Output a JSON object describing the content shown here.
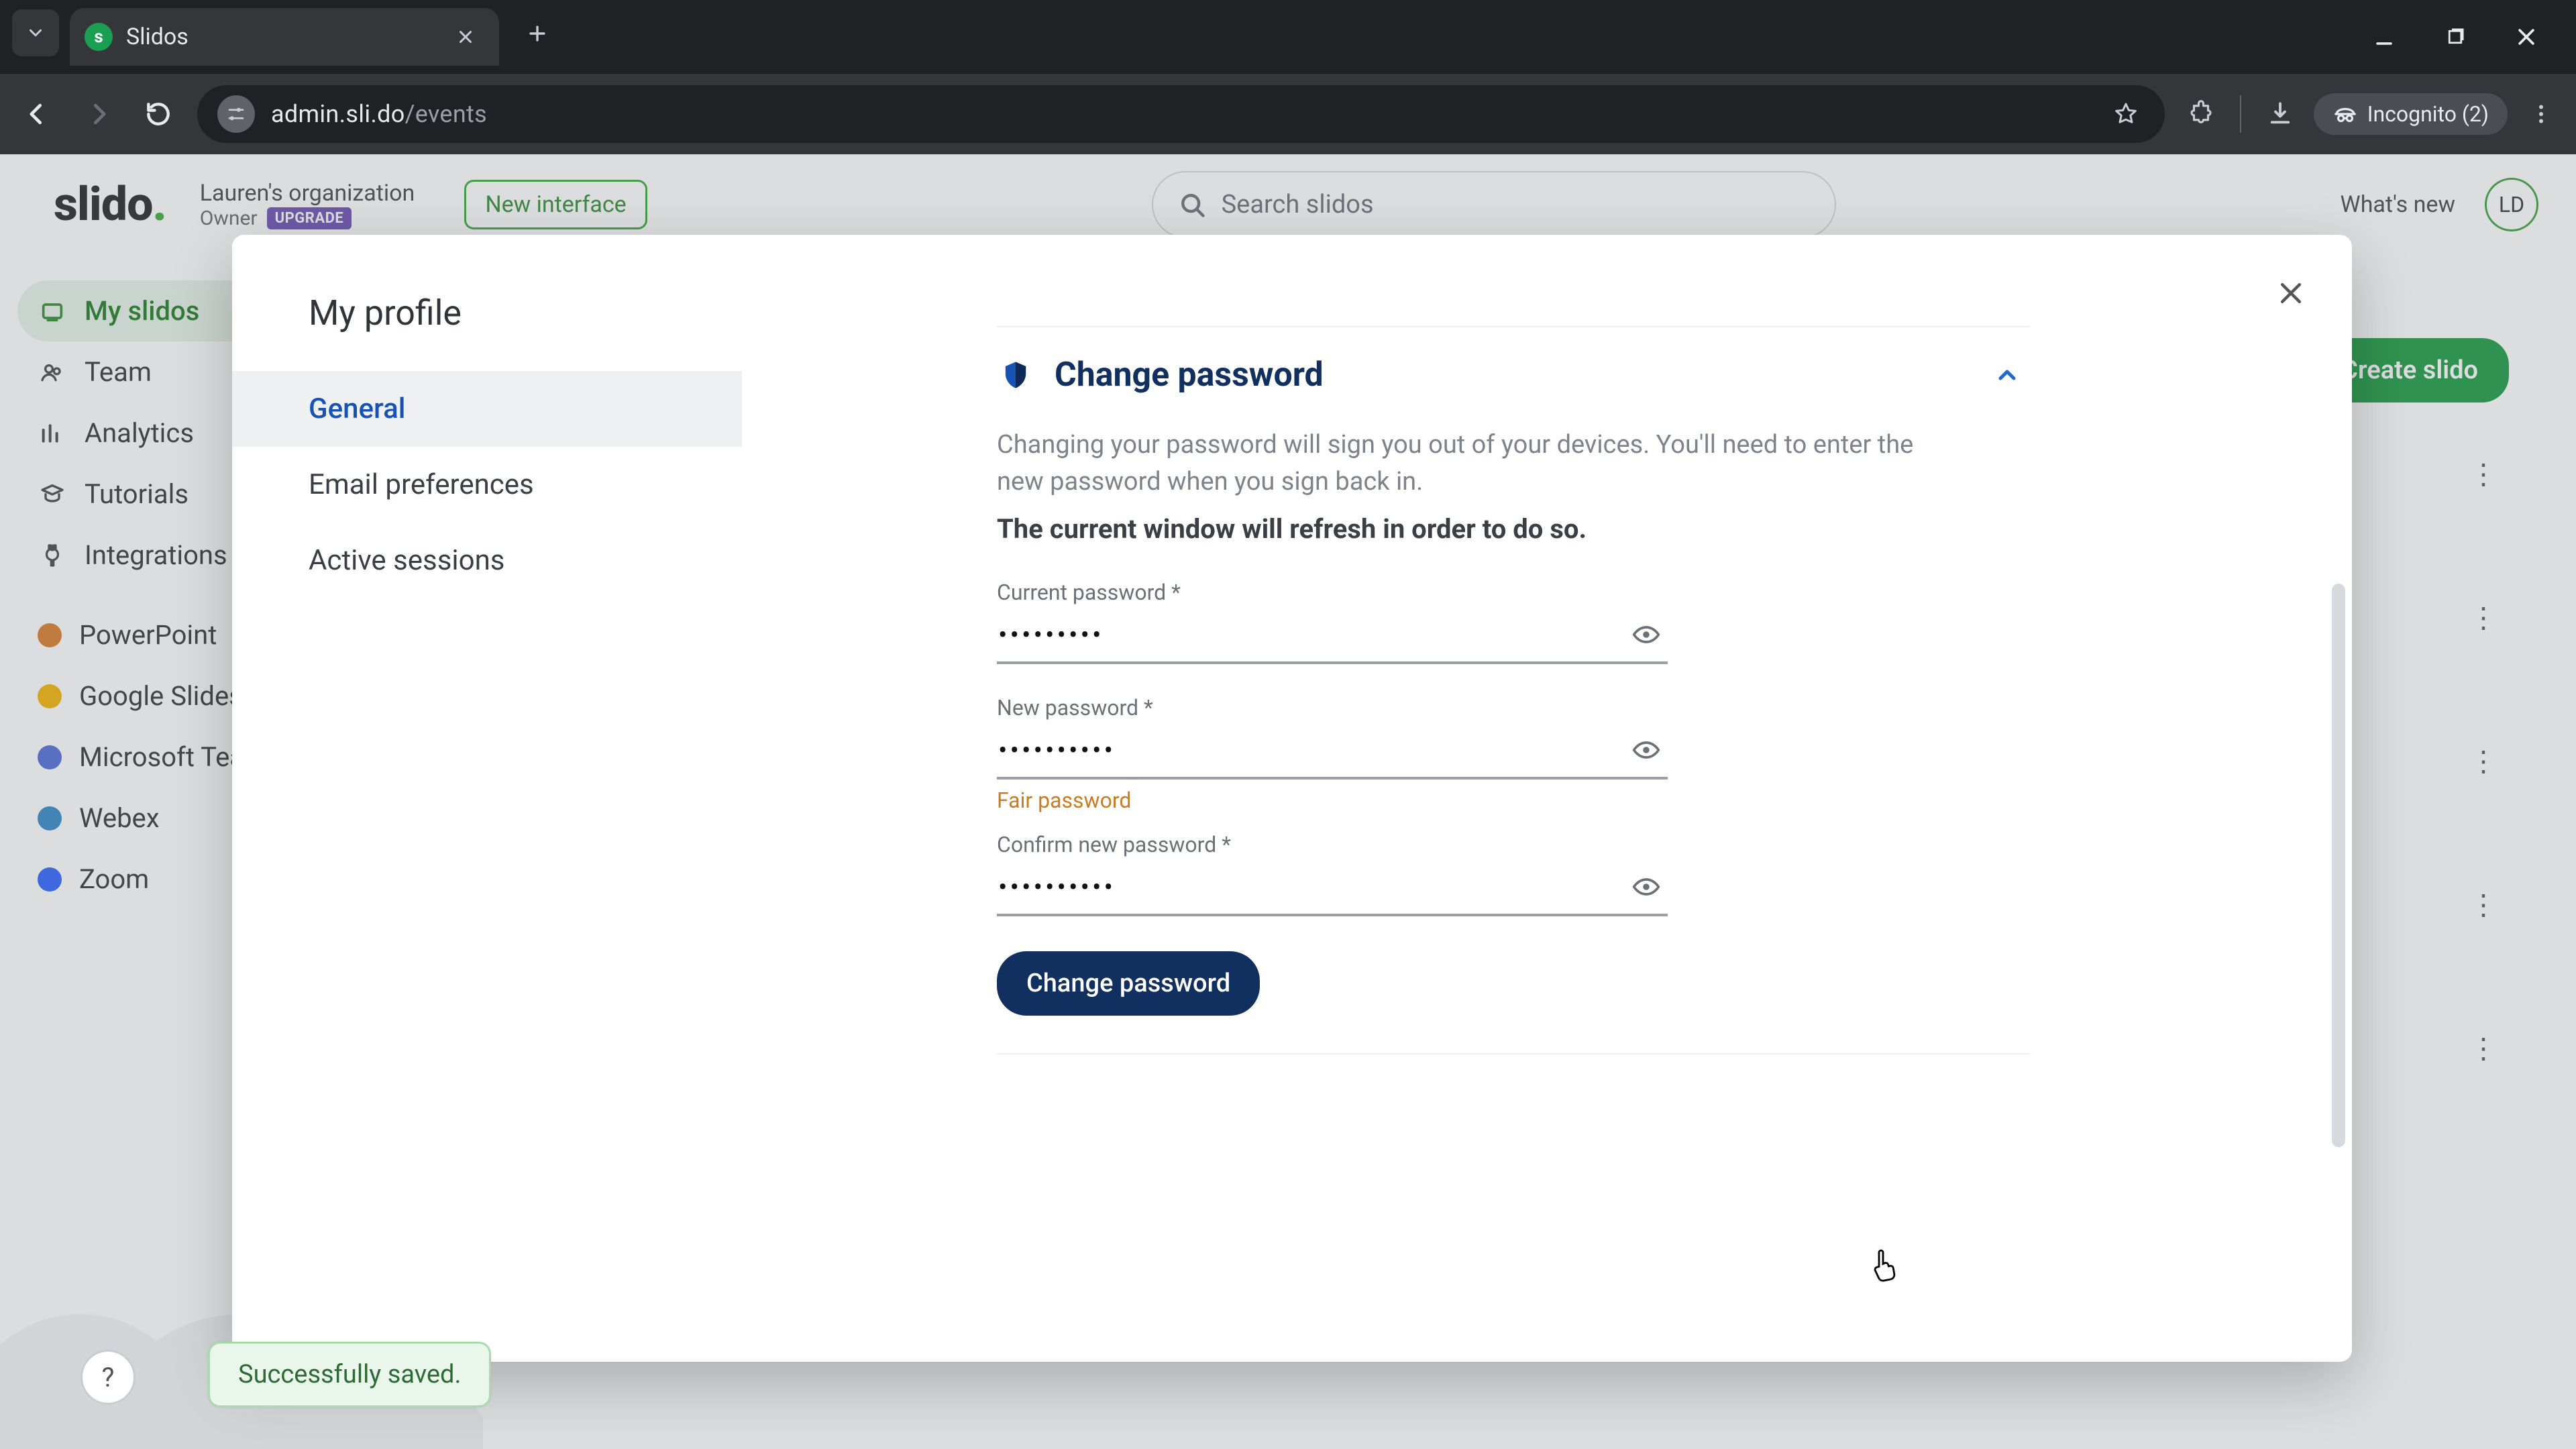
{
  "browser": {
    "tab_title": "Slidos",
    "url_host": "admin.sli.do",
    "url_path": "/events",
    "incognito_label": "Incognito (2)"
  },
  "header": {
    "logo_text": "slido",
    "org_name": "Lauren's organization",
    "owner_label": "Owner",
    "upgrade_badge": "UPGRADE",
    "new_interface": "New interface",
    "search_placeholder": "Search slidos",
    "whats_new": "What's new",
    "avatar_initials": "LD"
  },
  "sidebar": {
    "items": [
      {
        "label": "My slidos"
      },
      {
        "label": "Team"
      },
      {
        "label": "Analytics"
      },
      {
        "label": "Tutorials"
      },
      {
        "label": "Integrations"
      }
    ],
    "integrations": [
      {
        "label": "PowerPoint"
      },
      {
        "label": "Google Slides"
      },
      {
        "label": "Microsoft Teams"
      },
      {
        "label": "Webex"
      },
      {
        "label": "Zoom"
      }
    ]
  },
  "create_button": "Create slido",
  "toast": "Successfully saved.",
  "help_glyph": "?",
  "modal": {
    "title": "My profile",
    "nav": {
      "general": "General",
      "email_prefs": "Email preferences",
      "active_sessions": "Active sessions"
    },
    "panel": {
      "title": "Change password",
      "info_line1": "Changing your password will sign you out of your devices. You'll need to enter the new password when you sign back in.",
      "info_line2": "The current window will refresh in order to do so.",
      "current_label": "Current password *",
      "current_value": "•••••••••",
      "new_label": "New password *",
      "new_value": "••••••••••",
      "strength": "Fair password",
      "confirm_label": "Confirm new password *",
      "confirm_value": "••••••••••",
      "submit": "Change password"
    }
  }
}
